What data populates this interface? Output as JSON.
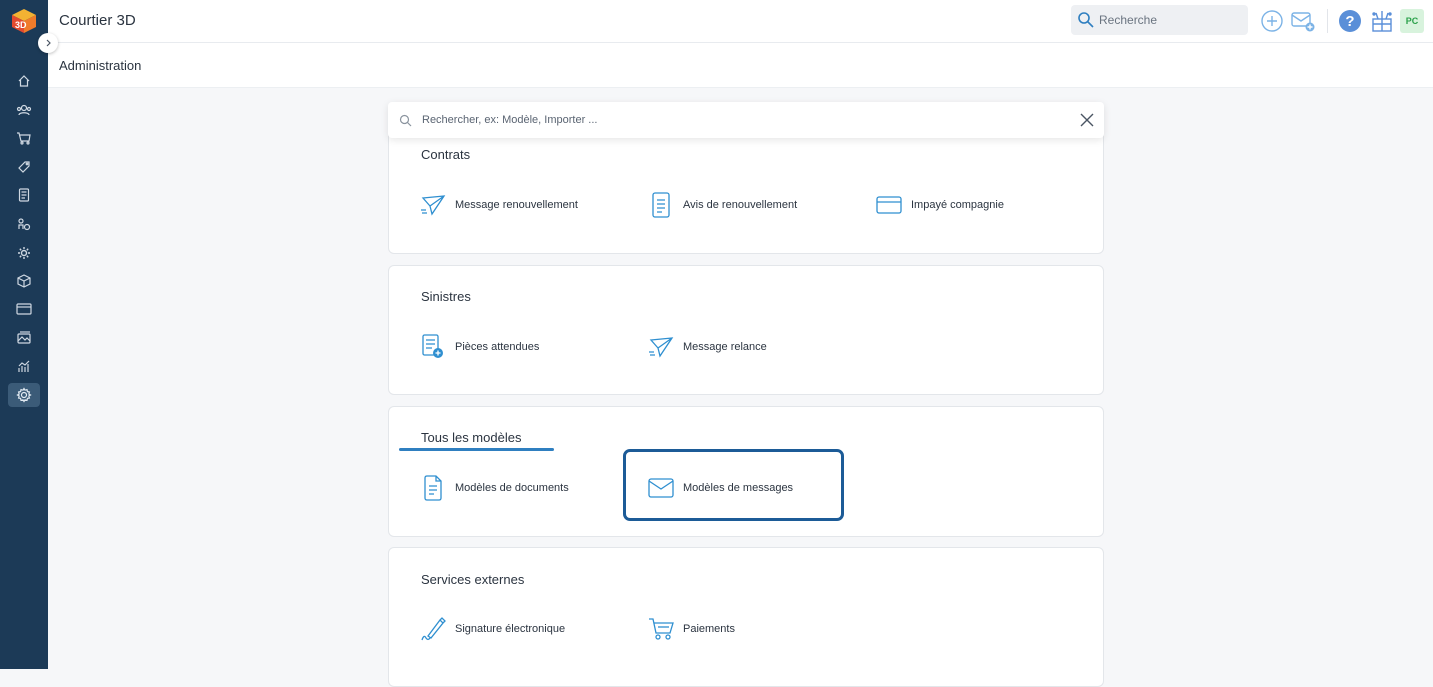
{
  "app": {
    "title": "Courtier 3D"
  },
  "topbar": {
    "search_placeholder": "Recherche",
    "avatar_initials": "PC"
  },
  "page": {
    "title": "Administration"
  },
  "main_search": {
    "placeholder": "Rechercher, ex: Modèle, Importer ..."
  },
  "sidebar": {
    "items": [
      {
        "icon": "home-icon"
      },
      {
        "icon": "users-icon"
      },
      {
        "icon": "cart-icon"
      },
      {
        "icon": "tag-icon"
      },
      {
        "icon": "document-icon"
      },
      {
        "icon": "claims-icon"
      },
      {
        "icon": "cog-icon"
      },
      {
        "icon": "box-icon"
      },
      {
        "icon": "card-icon"
      },
      {
        "icon": "gallery-icon"
      },
      {
        "icon": "stats-icon"
      },
      {
        "icon": "settings-icon",
        "active": true
      }
    ]
  },
  "sections": {
    "contrats": {
      "title": "Contrats",
      "items": [
        {
          "label": "Message renouvellement",
          "icon": "paper-plane-icon"
        },
        {
          "label": "Avis de renouvellement",
          "icon": "document-icon"
        },
        {
          "label": "Impayé compagnie",
          "icon": "credit-card-icon"
        }
      ]
    },
    "sinistres": {
      "title": "Sinistres",
      "items": [
        {
          "label": "Pièces attendues",
          "icon": "document-add-icon"
        },
        {
          "label": "Message relance",
          "icon": "paper-plane-icon"
        }
      ]
    },
    "modeles": {
      "title": "Tous les modèles",
      "items": [
        {
          "label": "Modèles de documents",
          "icon": "document-icon"
        },
        {
          "label": "Modèles de messages",
          "icon": "envelope-icon"
        }
      ]
    },
    "services": {
      "title": "Services externes",
      "items": [
        {
          "label": "Signature électronique",
          "icon": "pen-icon"
        },
        {
          "label": "Paiements",
          "icon": "cart-icon"
        }
      ]
    }
  },
  "colors": {
    "sidebar": "#1c3a57",
    "accent": "#2f8fd0",
    "highlight": "#1c5b97"
  }
}
